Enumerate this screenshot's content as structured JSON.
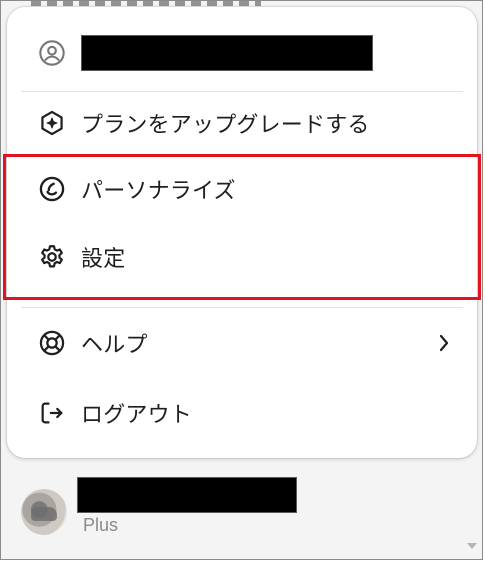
{
  "menu": {
    "account": {
      "name_redacted": ""
    },
    "items": [
      {
        "id": "upgrade",
        "label": "プランをアップグレードする",
        "icon": "sparkle-hex-icon"
      },
      {
        "id": "personalize",
        "label": "パーソナライズ",
        "icon": "personalize-icon"
      },
      {
        "id": "settings",
        "label": "設定",
        "icon": "gear-icon"
      },
      {
        "id": "help",
        "label": "ヘルプ",
        "icon": "lifebuoy-icon",
        "has_submenu": true
      },
      {
        "id": "logout",
        "label": "ログアウト",
        "icon": "logout-icon"
      }
    ]
  },
  "profile": {
    "plan": "Plus"
  },
  "colors": {
    "highlight": "#e0141e",
    "menu_bg": "#ffffff",
    "page_bg": "#f4f4f4",
    "muted_text": "#8a8a8a"
  }
}
